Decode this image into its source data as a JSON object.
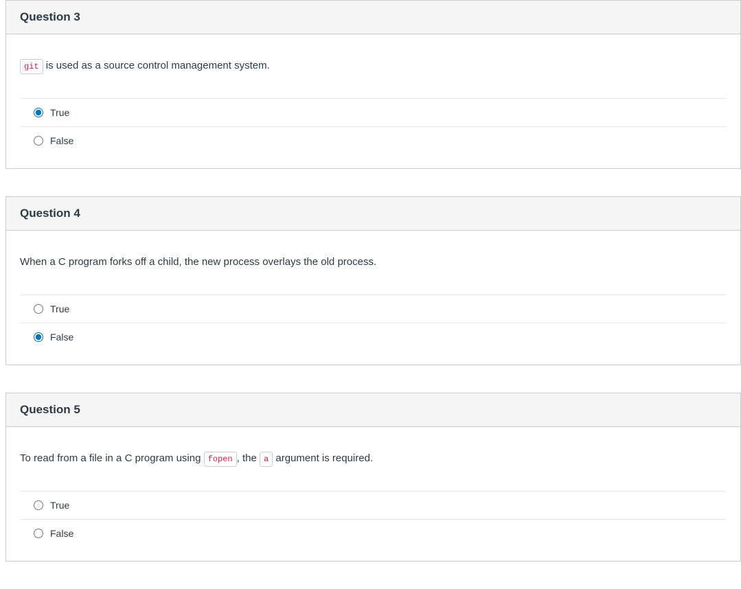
{
  "questions": [
    {
      "id": "q3",
      "title": "Question 3",
      "text_pre_code": "",
      "code1": "git",
      "text_mid": " is used as a source control management system.",
      "code2": "",
      "text_post": "",
      "options": [
        {
          "label": "True",
          "checked": true
        },
        {
          "label": "False",
          "checked": false
        }
      ]
    },
    {
      "id": "q4",
      "title": "Question 4",
      "text_pre_code": "When a C program forks off a child, the new process overlays the old process.",
      "code1": "",
      "text_mid": "",
      "code2": "",
      "text_post": "",
      "options": [
        {
          "label": "True",
          "checked": false
        },
        {
          "label": "False",
          "checked": true
        }
      ]
    },
    {
      "id": "q5",
      "title": "Question 5",
      "text_pre_code": "To read from a file in a C program using ",
      "code1": "fopen",
      "text_mid": ", the ",
      "code2": "a",
      "text_post": " argument is required.",
      "options": [
        {
          "label": "True",
          "checked": false
        },
        {
          "label": "False",
          "checked": false
        }
      ]
    }
  ]
}
